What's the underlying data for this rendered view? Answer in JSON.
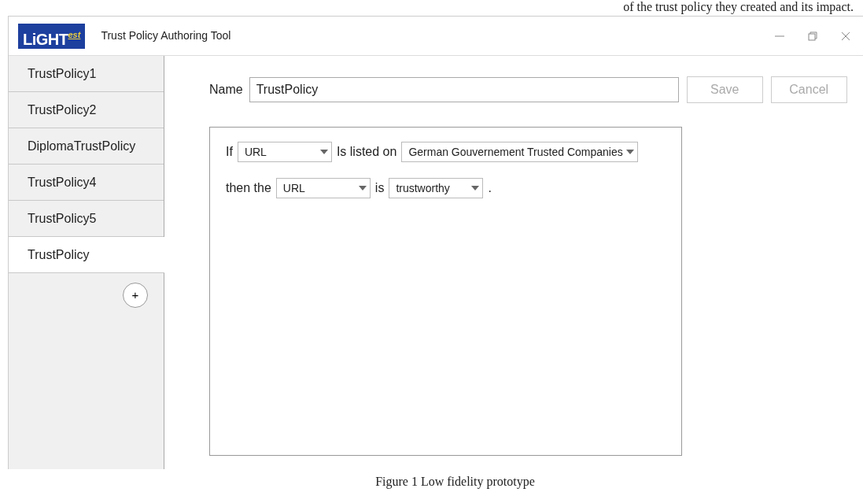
{
  "document_text_above": "of the trust policy they created and its impact.",
  "window": {
    "logo": {
      "main": "LiGHT",
      "sup": "est"
    },
    "title": "Trust Policy Authoring Tool"
  },
  "sidebar": {
    "items": [
      {
        "label": "TrustPolicy1",
        "selected": false
      },
      {
        "label": "TrustPolicy2",
        "selected": false
      },
      {
        "label": "DiplomaTrustPolicy",
        "selected": false
      },
      {
        "label": "TrustPolicy4",
        "selected": false
      },
      {
        "label": "TrustPolicy5",
        "selected": false
      },
      {
        "label": "TrustPolicy",
        "selected": true
      }
    ],
    "add_button": "+"
  },
  "name_field": {
    "label": "Name",
    "value": "TrustPolicy"
  },
  "buttons": [
    {
      "label": "Save",
      "disabled": true
    },
    {
      "label": "Cancel",
      "disabled": true
    }
  ],
  "rules": [
    [
      {
        "kind": "text",
        "text": "If"
      },
      {
        "kind": "dropdown",
        "value": "URL"
      },
      {
        "kind": "text",
        "text": "Is listed on"
      },
      {
        "kind": "dropdown",
        "value": "German Gouvernement Trusted Companies"
      }
    ],
    [
      {
        "kind": "text",
        "text": "then the"
      },
      {
        "kind": "dropdown",
        "value": "URL"
      },
      {
        "kind": "text",
        "text": "is"
      },
      {
        "kind": "dropdown",
        "value": "trustworthy"
      },
      {
        "kind": "text",
        "text": "."
      }
    ]
  ],
  "caption": "Figure 1 Low fidelity prototype"
}
